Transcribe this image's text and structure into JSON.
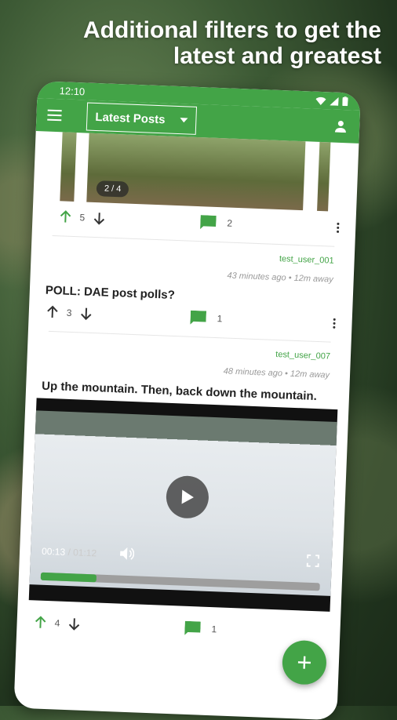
{
  "headline": {
    "line1": "Additional filters to get the",
    "line2": "latest and greatest"
  },
  "status": {
    "time": "12:10"
  },
  "appbar": {
    "filter_value": "Latest Posts"
  },
  "colors": {
    "accent": "#43a447"
  },
  "posts": [
    {
      "pager": "2 / 4",
      "score": "5",
      "comments": "2"
    },
    {
      "user": "test_user_001",
      "meta": "43 minutes ago • 12m away",
      "title": "POLL: DAE post polls?",
      "score": "3",
      "comments": "1"
    },
    {
      "user": "test_user_007",
      "meta": "48 minutes ago • 12m away",
      "title": "Up the mountain. Then, back down the mountain.",
      "score": "4",
      "comments": "1",
      "video": {
        "current": "00:13",
        "duration": "/ 01:12",
        "progress": 0.2
      }
    }
  ],
  "icons": [
    "menu-icon",
    "chevron-down-icon",
    "person-icon",
    "upvote-icon",
    "downvote-icon",
    "comment-icon",
    "more-vert-icon",
    "play-icon",
    "volume-icon",
    "fullscreen-icon",
    "add-icon"
  ]
}
